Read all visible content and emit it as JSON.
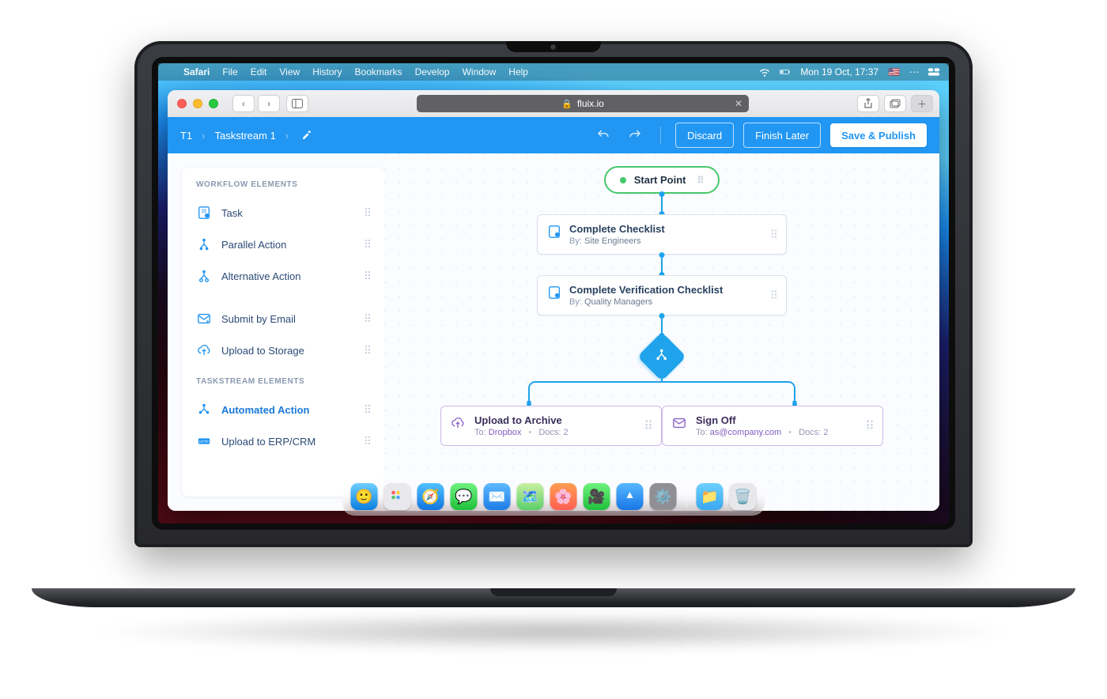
{
  "macos": {
    "menu": {
      "app": "Safari",
      "items": [
        "File",
        "Edit",
        "View",
        "History",
        "Bookmarks",
        "Develop",
        "Window",
        "Help"
      ]
    },
    "status": {
      "clock": "Mon 19 Oct, 17:37",
      "flag": "🇺🇸"
    }
  },
  "safari": {
    "url_host": "fluix.io"
  },
  "appbar": {
    "breadcrumb_short": "T1",
    "breadcrumb_name": "Taskstream 1",
    "btn_discard": "Discard",
    "btn_finish": "Finish Later",
    "btn_publish": "Save & Publish"
  },
  "sidebar": {
    "section1": "WORKFLOW ELEMENTS",
    "section2": "TASKSTREAM ELEMENTS",
    "items1": [
      {
        "label": "Task"
      },
      {
        "label": "Parallel Action"
      },
      {
        "label": "Alternative Action"
      },
      {
        "label": "Submit by Email"
      },
      {
        "label": "Upload to Storage"
      }
    ],
    "items2": [
      {
        "label": "Automated Action"
      },
      {
        "label": "Upload to ERP/CRM"
      }
    ]
  },
  "flow": {
    "start": "Start Point",
    "node1": {
      "title": "Complete Checklist",
      "by_label": "By:",
      "by_value": "Site Engineers"
    },
    "node2": {
      "title": "Complete Verification Checklist",
      "by_label": "By:",
      "by_value": "Quality Managers"
    },
    "leaf1": {
      "title": "Upload to Archive",
      "to_label": "To:",
      "to_value": "Dropbox",
      "docs_label": "Docs:",
      "docs_value": "2"
    },
    "leaf2": {
      "title": "Sign Off",
      "to_label": "To:",
      "to_value": "as@company.com",
      "docs_label": "Docs:",
      "docs_value": "2"
    }
  },
  "dock": {
    "apps": [
      "finder",
      "launchpad",
      "safari-app",
      "messages",
      "mail",
      "maps",
      "photos",
      "facetime",
      "appstore",
      "settings"
    ],
    "right": [
      "files",
      "trash"
    ]
  }
}
